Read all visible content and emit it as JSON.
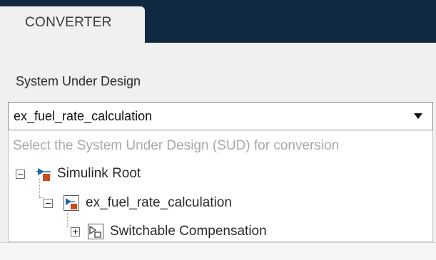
{
  "toolstrip": {
    "active_tab": "CONVERTER"
  },
  "system_under_design": {
    "label": "System Under Design",
    "selected_value": "ex_fuel_rate_calculation",
    "dropdown": {
      "hint": "Select the System Under Design (SUD) for conversion",
      "tree": [
        {
          "label": "Simulink Root",
          "expander": "collapse",
          "icon": "simulink-root-icon",
          "depth": 0
        },
        {
          "label": "ex_fuel_rate_calculation",
          "expander": "collapse",
          "icon": "model-icon",
          "depth": 1
        },
        {
          "label": "Switchable Compensation",
          "expander": "expand",
          "icon": "subsystem-icon",
          "depth": 2
        }
      ]
    }
  },
  "colors": {
    "toolstrip_bg": "#0f2940",
    "panel_bg": "#f0f0f0",
    "model_accent": "#cc4a1c",
    "simulink_blue": "#1d66b0"
  }
}
